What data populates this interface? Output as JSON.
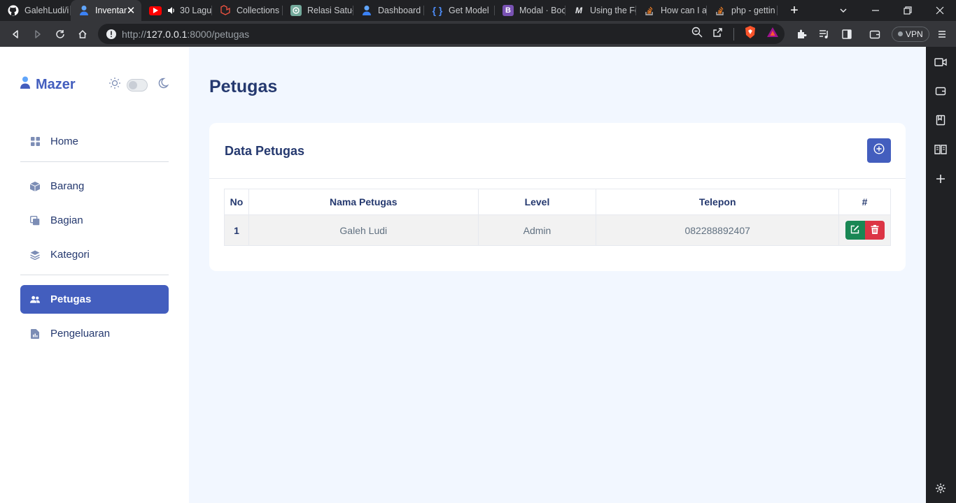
{
  "browser": {
    "tabs": [
      {
        "title": "GalehLudi/i",
        "favicon": "github-icon",
        "active": false
      },
      {
        "title": "Inventar",
        "favicon": "user-icon",
        "active": true
      },
      {
        "title": "30 Lagu",
        "favicon": "youtube-icon",
        "active": false,
        "audio": true
      },
      {
        "title": "Collections",
        "favicon": "laravel-icon",
        "active": false
      },
      {
        "title": "Relasi Satu-",
        "favicon": "openai-icon",
        "active": false
      },
      {
        "title": "Dashboard",
        "favicon": "user-icon",
        "active": false
      },
      {
        "title": "Get Model",
        "favicon": "braces-icon",
        "active": false
      },
      {
        "title": "Modal · Boo",
        "favicon": "bootstrap-icon",
        "active": false
      },
      {
        "title": "Using the Fe",
        "favicon": "medium-icon",
        "active": false
      },
      {
        "title": "How can I a",
        "favicon": "stackoverflow-icon",
        "active": false
      },
      {
        "title": "php - gettin",
        "favicon": "stackoverflow-icon",
        "active": false
      }
    ],
    "url_prefix": "http://",
    "url_host": "127.0.0.1",
    "url_rest": ":8000/petugas",
    "vpn_label": "VPN",
    "colors": {
      "tabbar": "#202124",
      "toolbar": "#35363a"
    }
  },
  "sidebar": {
    "brand": "Mazer",
    "menu": [
      {
        "label": "Home",
        "icon": "grid-icon",
        "active": false
      },
      {
        "label": "Barang",
        "icon": "box-icon",
        "active": false
      },
      {
        "label": "Bagian",
        "icon": "layers-square-icon",
        "active": false
      },
      {
        "label": "Kategori",
        "icon": "stack-icon",
        "active": false
      },
      {
        "label": "Petugas",
        "icon": "people-icon",
        "active": true
      },
      {
        "label": "Pengeluaran",
        "icon": "file-chart-icon",
        "active": false
      }
    ]
  },
  "main": {
    "title": "Petugas",
    "card_title": "Data Petugas",
    "table": {
      "headers": [
        "No",
        "Nama Petugas",
        "Level",
        "Telepon",
        "#"
      ],
      "rows": [
        {
          "no": "1",
          "nama": "Galeh Ludi",
          "level": "Admin",
          "telepon": "082288892407"
        }
      ]
    }
  },
  "colors": {
    "primary": "#435ebe",
    "title": "#25396f",
    "success": "#198754",
    "danger": "#dc3545",
    "background": "#f2f7ff"
  }
}
